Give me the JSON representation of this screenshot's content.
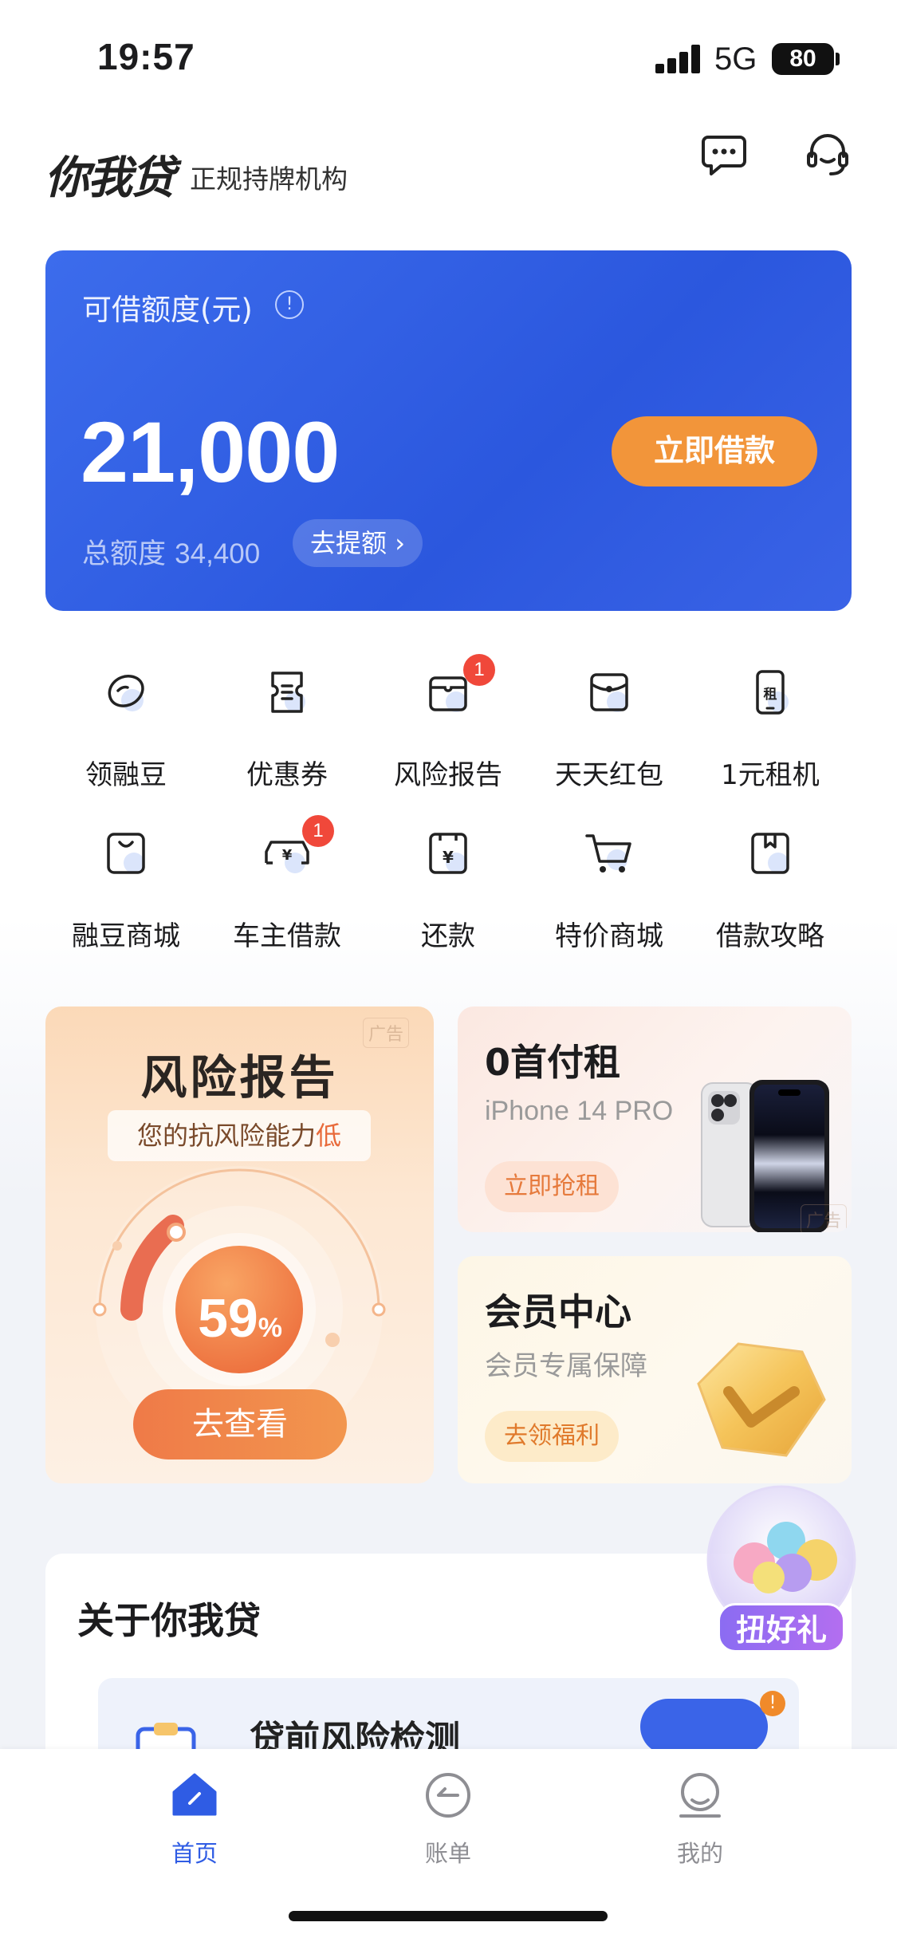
{
  "status_bar": {
    "time": "19:57",
    "network": "5G",
    "battery": "80"
  },
  "header": {
    "logo": "你我贷",
    "tagline": "正规持牌机构",
    "icons": [
      "message-icon",
      "customer-service-icon"
    ]
  },
  "credit": {
    "label": "可借额度(元)",
    "amount": "21,000",
    "borrow_button": "立即借款",
    "total_label": "总额度",
    "total_value": "34,400",
    "raise_button": "去提额"
  },
  "quick_grid": [
    {
      "label": "领融豆",
      "icon": "bean-icon"
    },
    {
      "label": "优惠券",
      "icon": "coupon-icon"
    },
    {
      "label": "风险报告",
      "icon": "report-icon",
      "badge": "1"
    },
    {
      "label": "天天红包",
      "icon": "red-packet-icon"
    },
    {
      "label": "1元租机",
      "icon": "phone-rent-icon"
    },
    {
      "label": "融豆商城",
      "icon": "bag-icon"
    },
    {
      "label": "车主借款",
      "icon": "car-loan-icon",
      "badge": "1"
    },
    {
      "label": "还款",
      "icon": "repay-icon"
    },
    {
      "label": "特价商城",
      "icon": "cart-icon"
    },
    {
      "label": "借款攻略",
      "icon": "guide-book-icon"
    }
  ],
  "risk_card": {
    "ad_tag": "广告",
    "title": "风险报告",
    "subtitle_prefix": "您的抗风险能力",
    "subtitle_level": "低",
    "percent": "59",
    "percent_sign": "%",
    "percent_value": 59,
    "button": "去查看"
  },
  "phone_card": {
    "title": "0首付租",
    "subtitle": "iPhone 14 PRO",
    "button": "立即抢租",
    "ad_tag": "广告"
  },
  "vip_card": {
    "title": "会员中心",
    "subtitle": "会员专属保障",
    "button": "去领福利"
  },
  "float_gift": {
    "label": "扭好礼"
  },
  "about": {
    "title": "关于你我贷",
    "inner_title": "贷前风险检测",
    "inner_badge": "!"
  },
  "bottom_nav": [
    {
      "label": "首页",
      "icon": "home-icon",
      "active": true
    },
    {
      "label": "账单",
      "icon": "bill-icon",
      "active": false
    },
    {
      "label": "我的",
      "icon": "profile-icon",
      "active": false
    }
  ],
  "colors": {
    "primary": "#2f5ce4",
    "accent_orange": "#f2953a",
    "badge_red": "#f0483a"
  }
}
